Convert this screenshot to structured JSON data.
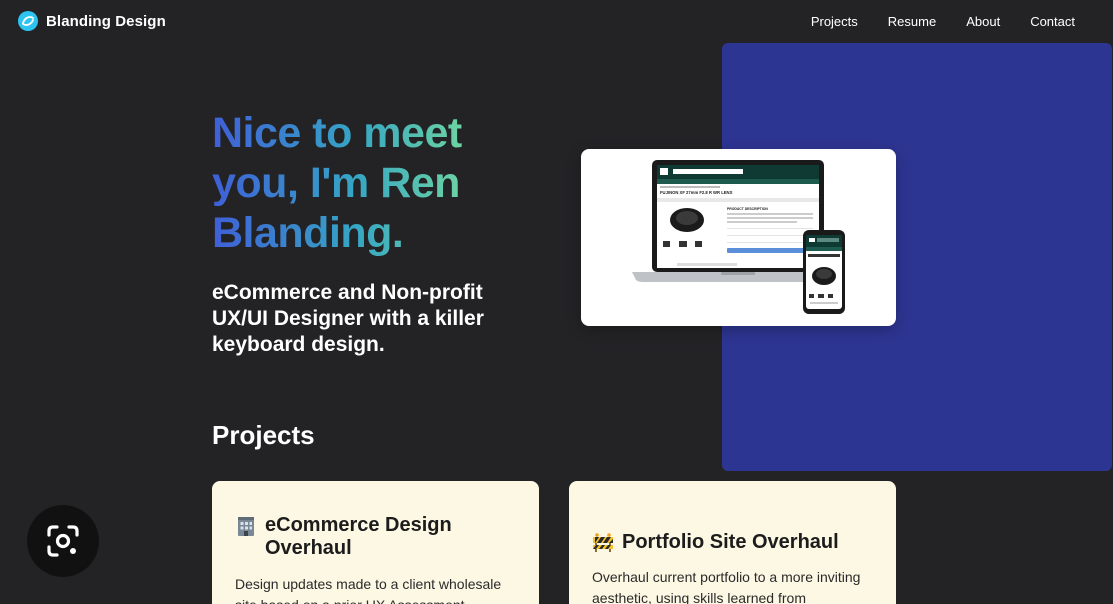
{
  "header": {
    "brand_name": "Blanding Design",
    "nav": [
      "Projects",
      "Resume",
      "About",
      "Contact"
    ]
  },
  "hero": {
    "headline": "Nice to meet you, I'm Ren Blanding.",
    "subheadline": "eCommerce and Non-profit UX/UI Designer with a killer keyboard design.",
    "mockup_product_title": "FUJINON XF 27mm F2.8 R WR LENS",
    "mockup_section_title": "PRODUCT DESCRIPTION"
  },
  "projects": {
    "title": "Projects",
    "cards": [
      {
        "icon": "office-building-icon",
        "title": "eCommerce Design Overhaul",
        "description": "Design updates made to a client wholesale site based on a prior UX Assessment"
      },
      {
        "icon": "construction-barrier-icon",
        "title": "Portfolio Site Overhaul",
        "description": "Overhaul current portfolio to a more inviting aesthetic, using skills learned from"
      }
    ]
  },
  "colors": {
    "background": "#232326",
    "accent_panel": "#2d3592",
    "card_background": "#fdf8e4",
    "gradient_start": "#3f5fd8",
    "gradient_end": "#6fd6a0"
  }
}
